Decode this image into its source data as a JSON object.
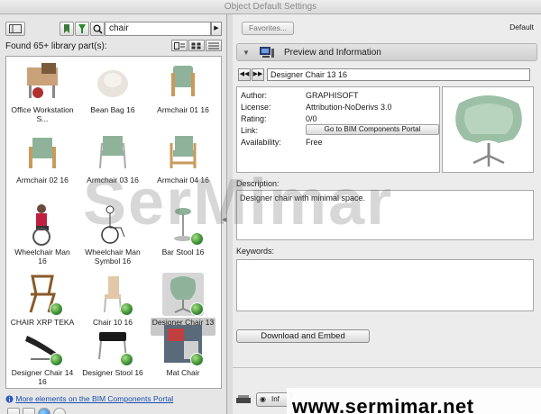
{
  "window": {
    "title": "Object Default Settings"
  },
  "left": {
    "search_value": "chair",
    "found_label": "Found 65+ library part(s):",
    "items": [
      {
        "label": "Office Workstation S..."
      },
      {
        "label": "Bean Bag 16"
      },
      {
        "label": "Armchair 01 16"
      },
      {
        "label": "Armchair 02 16"
      },
      {
        "label": "Armchair 03 16"
      },
      {
        "label": "Armchair 04 16"
      },
      {
        "label": "Wheelchair Man 16"
      },
      {
        "label": "Wheelchair Man Symbol 16"
      },
      {
        "label": "Bar Stool 16"
      },
      {
        "label": "CHAIR XRP TEKA"
      },
      {
        "label": "Chair 10 16"
      },
      {
        "label": "Designer Chair 13 16"
      },
      {
        "label": "Designer Chair 14 16"
      },
      {
        "label": "Designer Stool 16"
      },
      {
        "label": "Mat Chair"
      }
    ],
    "portal_link": "More elements on the BIM Components Portal"
  },
  "right": {
    "favorites_label": "Favorites...",
    "default_label": "Default",
    "section_title": "Preview and Information",
    "name_value": "Designer Chair 13 16",
    "info": {
      "author_key": "Author:",
      "author_value": "GRAPHISOFT",
      "license_key": "License:",
      "license_value": "Attribution-NoDerivs 3.0",
      "rating_key": "Rating:",
      "rating_value": "0/0",
      "link_key": "Link:",
      "link_button": "Go to BIM Components Portal",
      "availability_key": "Availability:",
      "availability_value": "Free"
    },
    "description_label": "Description:",
    "description_text": "Designer chair with minimal space.",
    "keywords_label": "Keywords:",
    "keywords_text": "",
    "download_button": "Download and Embed",
    "bottom_button": "Inf"
  },
  "watermarks": {
    "overlay": "SerMimar",
    "url": "www.sermimar.net"
  },
  "colors": {
    "link": "#1a4fb0",
    "chair_green": "#8fb39a"
  }
}
